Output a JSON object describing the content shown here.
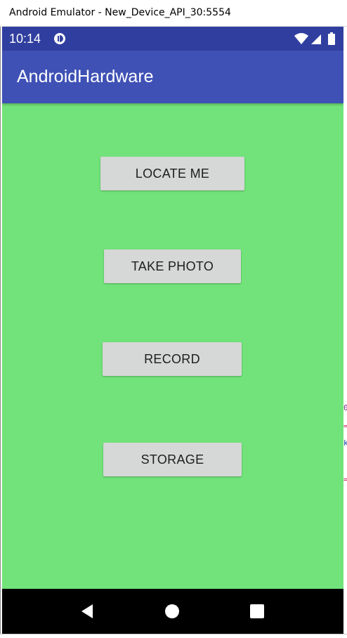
{
  "window": {
    "title": "Android Emulator - New_Device_API_30:5554"
  },
  "status_bar": {
    "time": "10:14",
    "icons": [
      "app-notification-icon",
      "wifi-icon",
      "signal-icon",
      "battery-icon"
    ]
  },
  "app_bar": {
    "title": "AndroidHardware"
  },
  "main": {
    "background_color": "#72e37a",
    "buttons": [
      {
        "label": "LOCATE ME"
      },
      {
        "label": "TAKE PHOTO"
      },
      {
        "label": "RECORD"
      },
      {
        "label": "STORAGE"
      }
    ]
  },
  "nav_bar": {
    "buttons": [
      "back-icon",
      "home-icon",
      "recents-icon"
    ]
  },
  "colors": {
    "status_bar": "#303f9f",
    "app_bar": "#3f51b5",
    "button": "#d6d7d7",
    "nav_bar": "#000000"
  }
}
